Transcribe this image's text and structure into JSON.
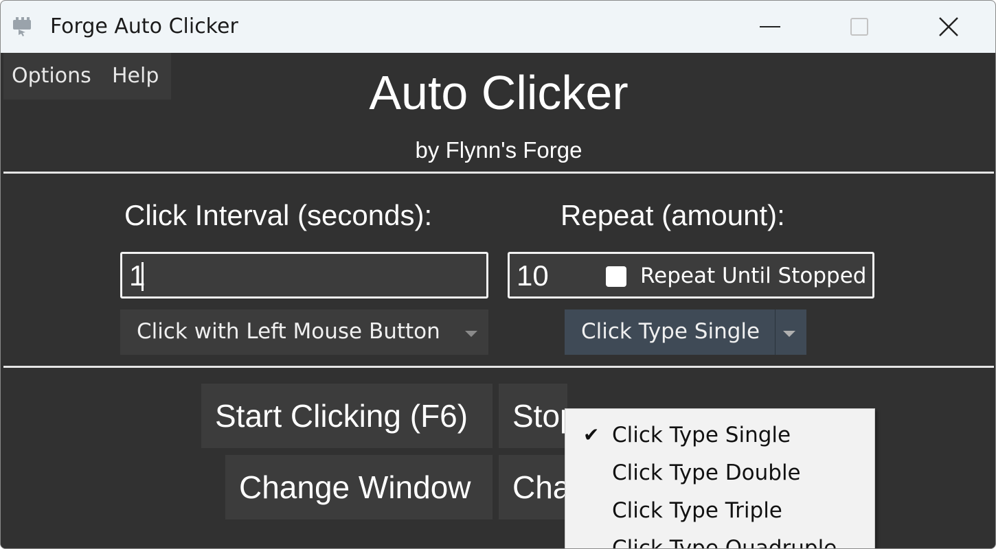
{
  "window": {
    "title": "Forge Auto Clicker",
    "icon": "app-logo-icon",
    "controls": {
      "minimize": "minimize-icon",
      "maximize": "maximize-icon",
      "close": "✕"
    }
  },
  "menu": {
    "options": "Options",
    "help": "Help"
  },
  "header": {
    "title": "Auto Clicker",
    "subtitle": "by Flynn's Forge"
  },
  "interval": {
    "label": "Click Interval (seconds):",
    "value": "1"
  },
  "repeat": {
    "label": "Repeat (amount):",
    "value": "10",
    "until_stopped_label": "Repeat Until Stopped",
    "until_stopped_checked": false
  },
  "mouse_button": {
    "selected": "Click with Left Mouse Button"
  },
  "click_type": {
    "selected": "Click Type Single",
    "options": [
      "Click Type Single",
      "Click Type Double",
      "Click Type Triple",
      "Click Type Quadruple"
    ],
    "checked_mark": "✔"
  },
  "buttons": {
    "start": "Start Clicking (F6)",
    "stop_visible": "Stop",
    "change_window": "Change Window",
    "change_visible": "Cha"
  },
  "colors": {
    "background": "#313131",
    "titlebar": "#f0f5f8",
    "control": "#3c3c3c",
    "selected_dropdown": "#3f4a56",
    "popup": "#f2f2f2"
  }
}
